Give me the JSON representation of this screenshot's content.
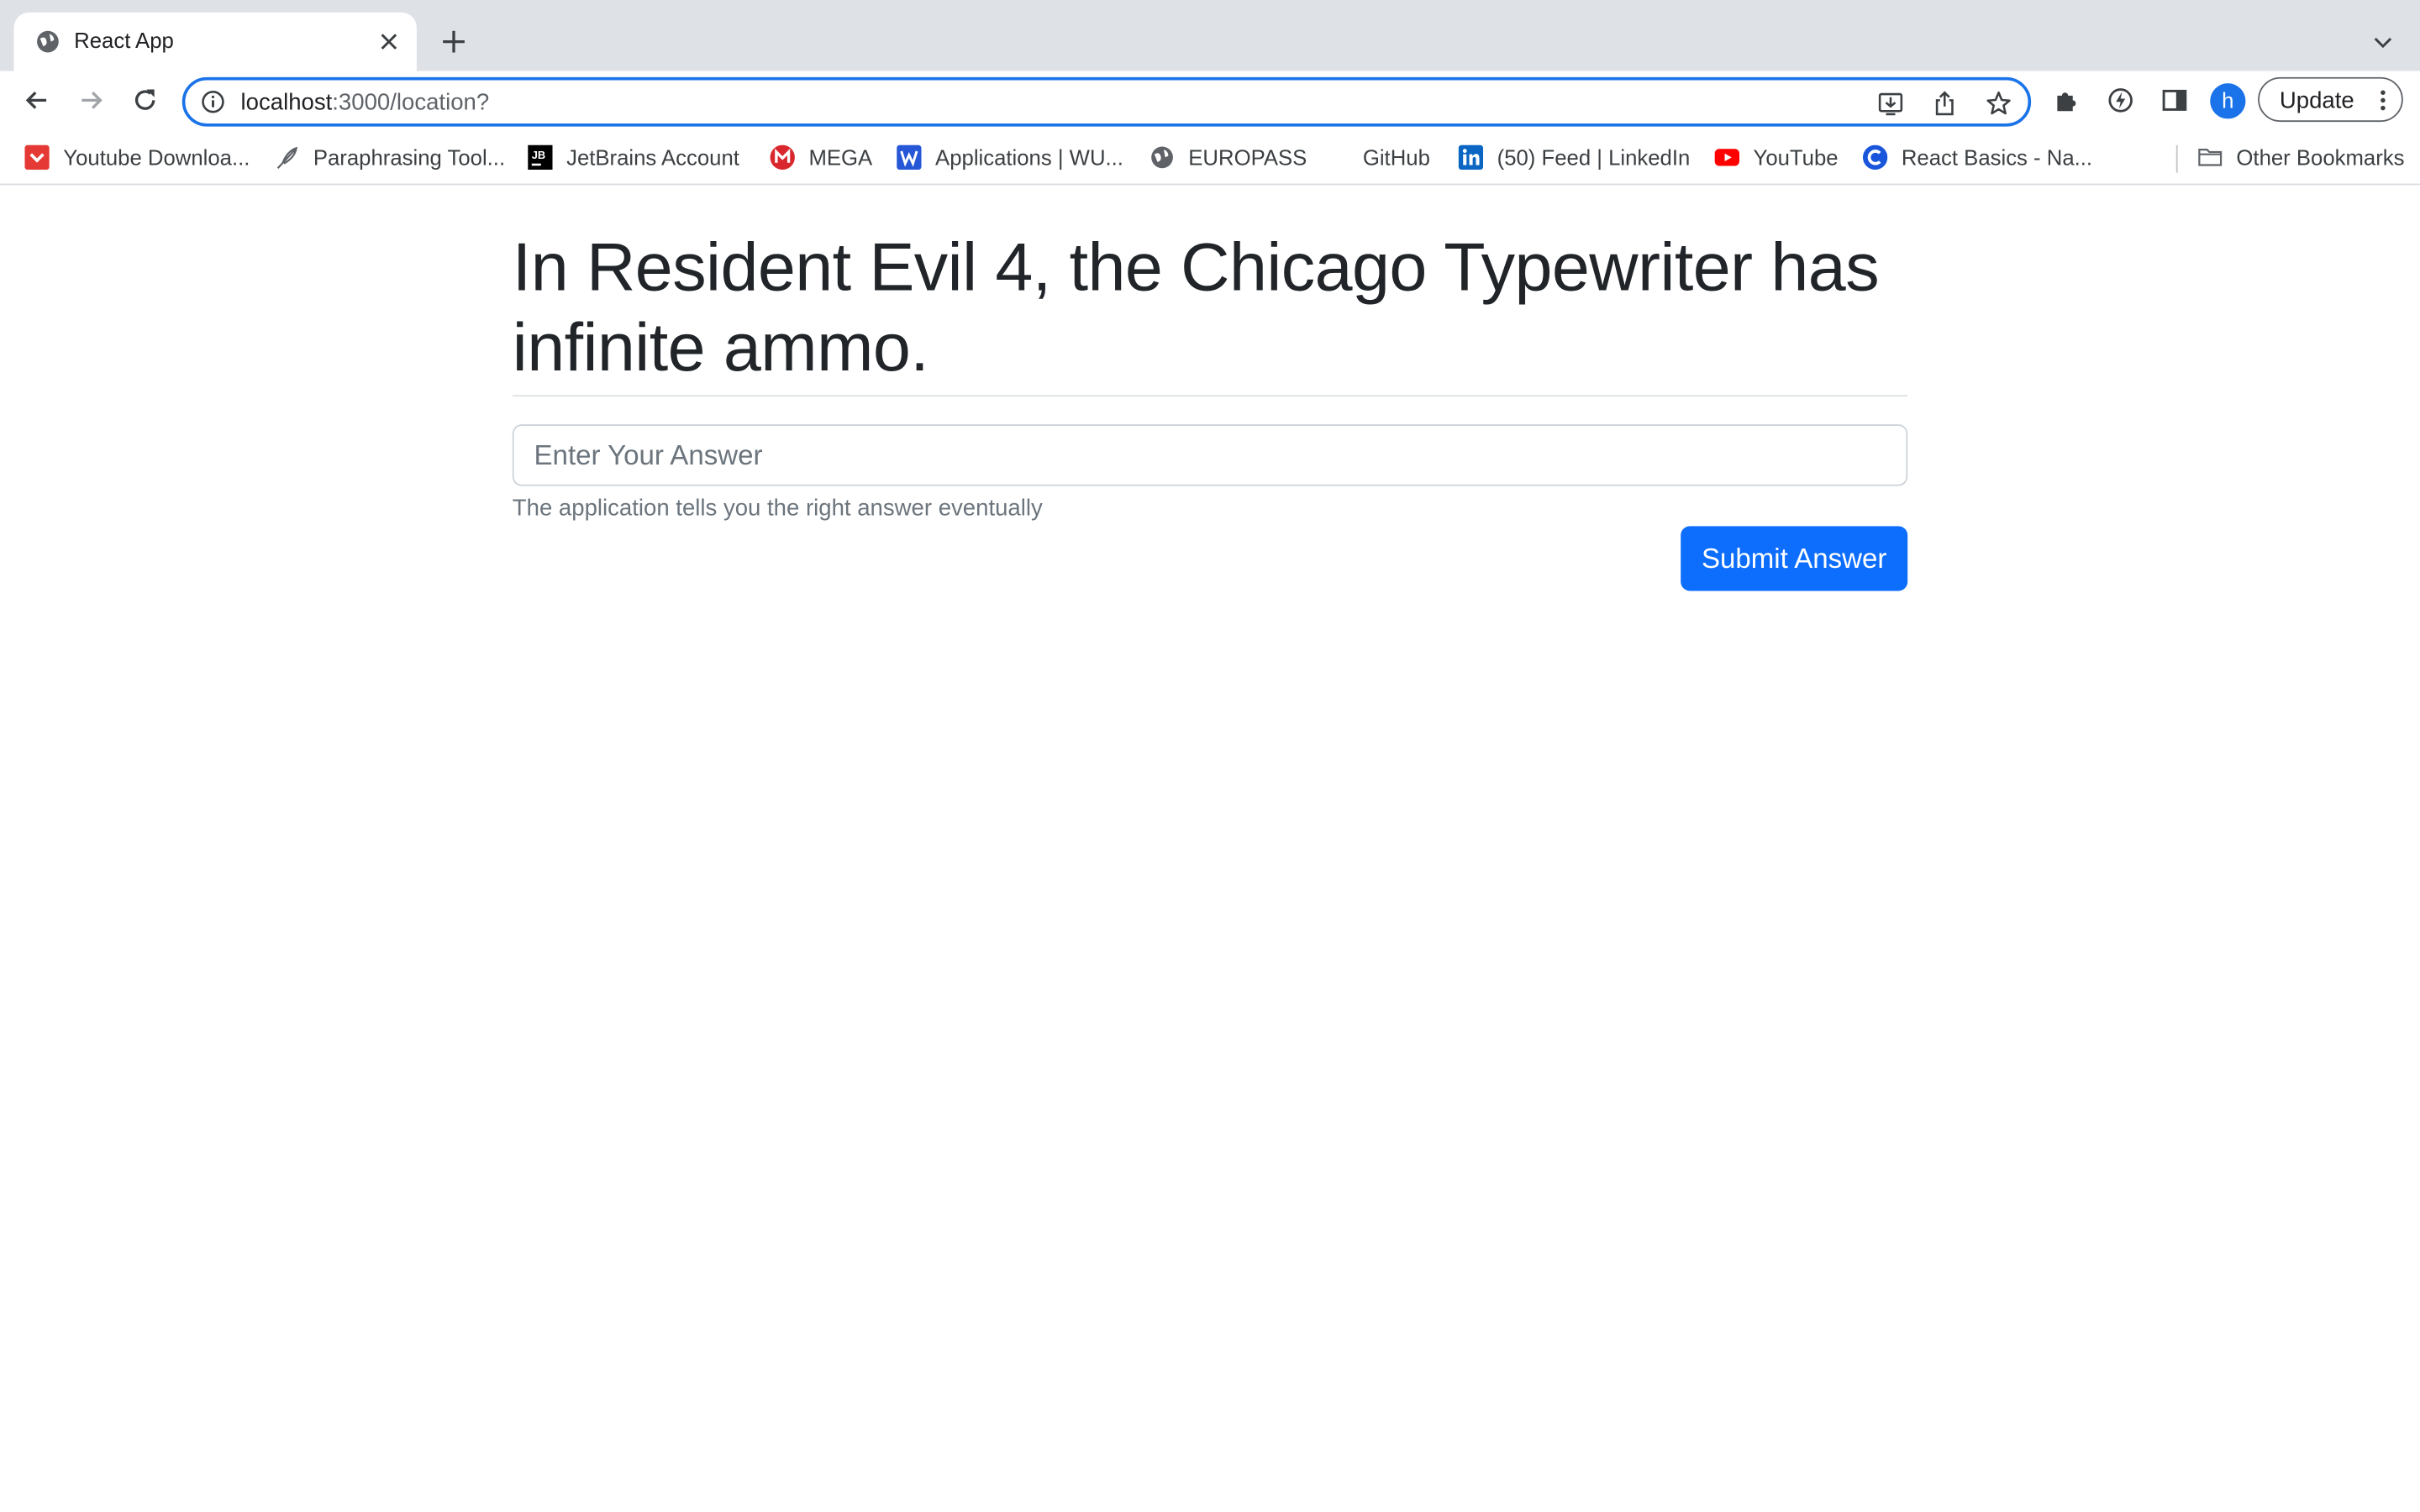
{
  "browser": {
    "tab": {
      "title": "React App"
    },
    "address_bar": {
      "host": "localhost",
      "path": ":3000/location?"
    },
    "profile_initial": "h",
    "update_label": "Update",
    "bookmarks": [
      {
        "label": "Youtube Downloa...",
        "icon": "youtube-downloader-icon"
      },
      {
        "label": "Paraphrasing Tool...",
        "icon": "feather-icon"
      },
      {
        "label": "JetBrains Account",
        "icon": "jetbrains-icon"
      },
      {
        "label": "MEGA",
        "icon": "mega-icon"
      },
      {
        "label": "Applications | WU...",
        "icon": "w-icon"
      },
      {
        "label": "EUROPASS",
        "icon": "globe-icon"
      },
      {
        "label": "GitHub",
        "icon": "github-icon"
      },
      {
        "label": "(50) Feed | LinkedIn",
        "icon": "linkedin-icon"
      },
      {
        "label": "YouTube",
        "icon": "youtube-icon"
      },
      {
        "label": "React Basics - Na...",
        "icon": "c-icon"
      }
    ],
    "other_bookmarks": "Other Bookmarks"
  },
  "page": {
    "question": "In Resident Evil 4, the Chicago Typewriter has infinite ammo.",
    "answer_placeholder": "Enter Your Answer",
    "answer_value": "",
    "hint": "The application tells you the right answer eventually",
    "submit_label": "Submit Answer"
  },
  "colors": {
    "primary": "#0d6efd",
    "focus_ring": "#1a73e8",
    "heading_text": "#212529",
    "muted_text": "#6c757d",
    "tabstrip": "#dee1e6"
  }
}
